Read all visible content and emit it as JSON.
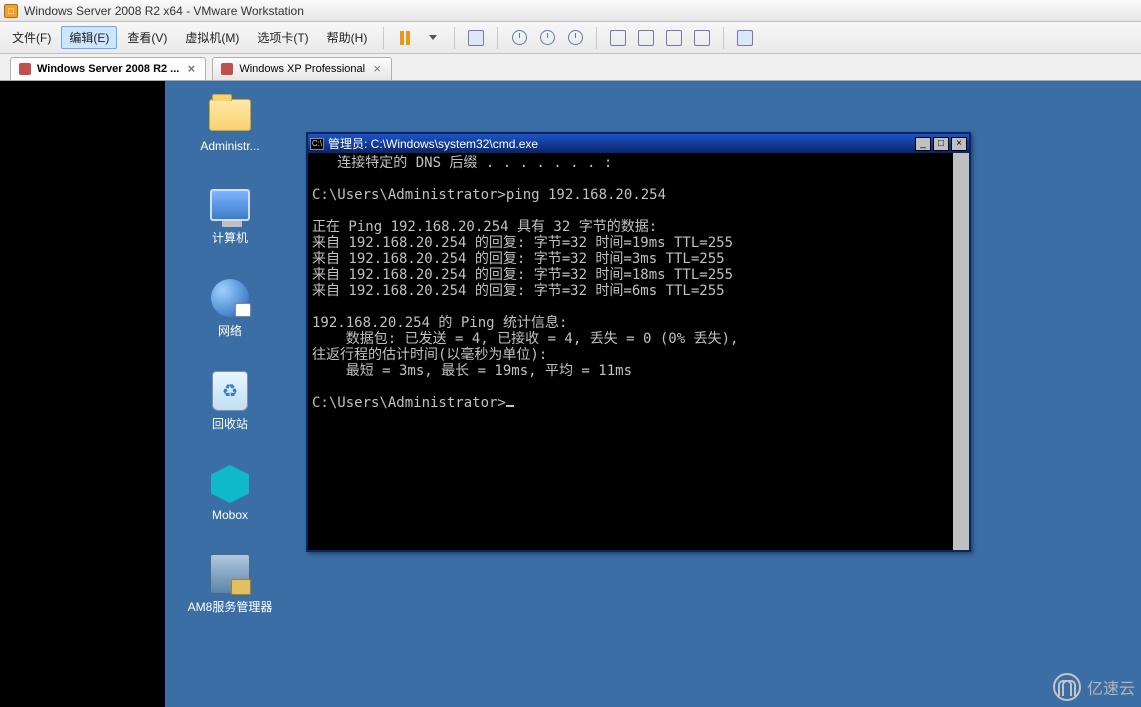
{
  "vmware": {
    "title": "Windows Server 2008 R2 x64 - VMware Workstation",
    "menu": {
      "file": "文件(F)",
      "edit": "编辑(E)",
      "view": "查看(V)",
      "vm": "虚拟机(M)",
      "tabs": "选项卡(T)",
      "help": "帮助(H)"
    },
    "tabs": [
      {
        "label": "Windows Server 2008 R2 ...",
        "active": true
      },
      {
        "label": "Windows XP Professional",
        "active": false
      }
    ]
  },
  "desktop": {
    "icons": [
      {
        "id": "administrator-folder",
        "label": "Administr..."
      },
      {
        "id": "computer",
        "label": "计算机"
      },
      {
        "id": "network",
        "label": "网络"
      },
      {
        "id": "recycle-bin",
        "label": "回收站"
      },
      {
        "id": "mobox",
        "label": "Mobox"
      },
      {
        "id": "am8-server-manager",
        "label": "AM8服务管理器"
      }
    ]
  },
  "cmd": {
    "title": "管理员: C:\\Windows\\system32\\cmd.exe",
    "lines": [
      "   连接特定的 DNS 后缀 . . . . . . . :",
      "",
      "C:\\Users\\Administrator>ping 192.168.20.254",
      "",
      "正在 Ping 192.168.20.254 具有 32 字节的数据:",
      "来自 192.168.20.254 的回复: 字节=32 时间=19ms TTL=255",
      "来自 192.168.20.254 的回复: 字节=32 时间=3ms TTL=255",
      "来自 192.168.20.254 的回复: 字节=32 时间=18ms TTL=255",
      "来自 192.168.20.254 的回复: 字节=32 时间=6ms TTL=255",
      "",
      "192.168.20.254 的 Ping 统计信息:",
      "    数据包: 已发送 = 4, 已接收 = 4, 丢失 = 0 (0% 丢失),",
      "往返行程的估计时间(以毫秒为单位):",
      "    最短 = 3ms, 最长 = 19ms, 平均 = 11ms",
      "",
      "C:\\Users\\Administrator>"
    ],
    "prompt_cursor": true
  },
  "watermark": {
    "text": "亿速云"
  }
}
